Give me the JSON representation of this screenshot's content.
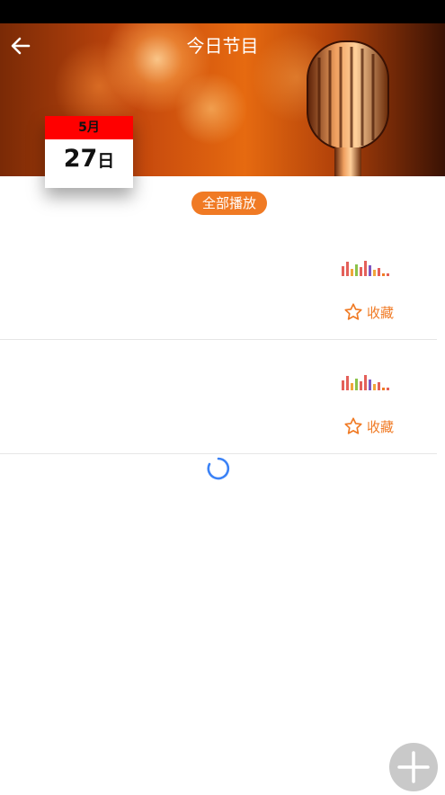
{
  "header": {
    "title": "今日节目"
  },
  "calendar": {
    "month": "5月",
    "day": "27",
    "day_unit": "日"
  },
  "play_all_label": "全部播放",
  "programs": [
    {
      "favorite_label": "收藏"
    },
    {
      "favorite_label": "收藏"
    }
  ],
  "colors": {
    "accent": "#f07a24",
    "calendar_header": "#ff0000",
    "spinner": "#3b82f6",
    "fab": "#c9c9c9"
  }
}
